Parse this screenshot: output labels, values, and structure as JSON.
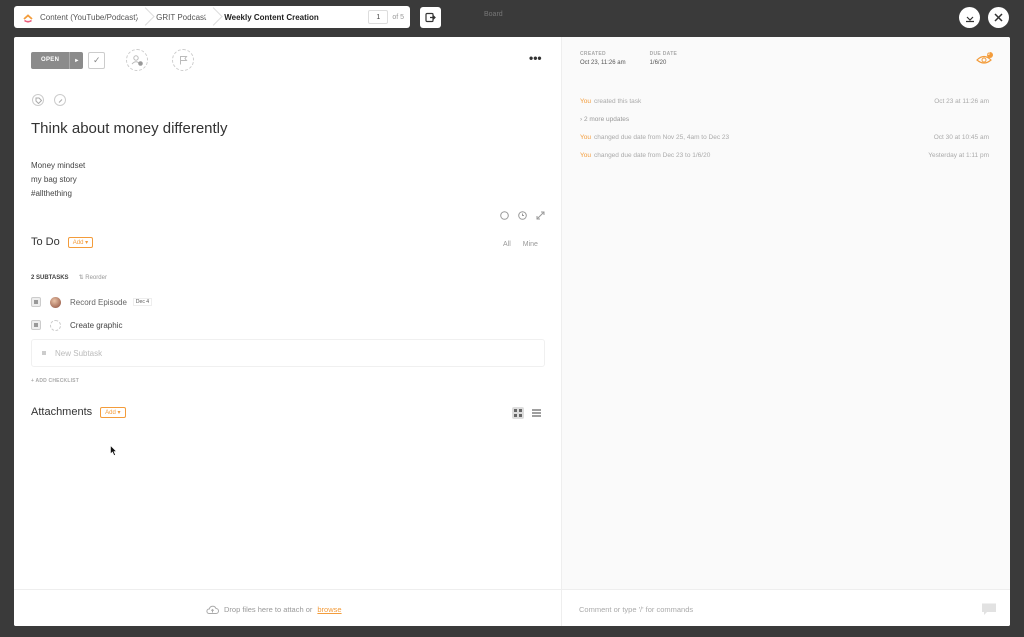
{
  "breadcrumb": {
    "items": [
      "Content (YouTube/Podcast)",
      "GRIT Podcast",
      "Weekly Content Creation"
    ],
    "position": "1",
    "total": "of 5"
  },
  "background": {
    "board_label": "Board"
  },
  "task": {
    "status": "OPEN",
    "title": "Think about money differently",
    "description": [
      "Money mindset",
      "my bag story",
      "#allthething"
    ]
  },
  "todo": {
    "title": "To Do",
    "add_label": "Add",
    "filter_all": "All",
    "filter_mine": "Mine",
    "subtask_count": "2 SUBTASKS",
    "reorder_label": "Reorder",
    "subtasks": [
      {
        "name": "Record Episode",
        "due": "Dec 4"
      },
      {
        "name": "Create graphic",
        "due": ""
      }
    ],
    "new_subtask_placeholder": "New Subtask",
    "add_checklist": "+ ADD CHECKLIST"
  },
  "attachments": {
    "title": "Attachments",
    "add_label": "Add"
  },
  "meta": {
    "created_label": "CREATED",
    "created_value": "Oct 23, 11:26 am",
    "due_label": "DUE DATE",
    "due_value": "1/6/20",
    "watchers_count": "2"
  },
  "activity": [
    {
      "who": "You",
      "text": "created this task",
      "time": "Oct 23 at 11:26 am"
    },
    {
      "who": "",
      "text": "› 2 more updates",
      "time": ""
    },
    {
      "who": "You",
      "text": "changed due date from Nov 25, 4am to Dec 23",
      "time": "Oct 30 at 10:45 am"
    },
    {
      "who": "You",
      "text": "changed due date from Dec 23 to 1/6/20",
      "time": "Yesterday at 1:11 pm"
    }
  ],
  "footer": {
    "drop_text": "Drop files here to attach or",
    "browse_label": "browse",
    "comment_placeholder": "Comment or type '/' for commands"
  },
  "colors": {
    "accent": "#f39c3b",
    "status_gray": "#8b8b8b"
  }
}
